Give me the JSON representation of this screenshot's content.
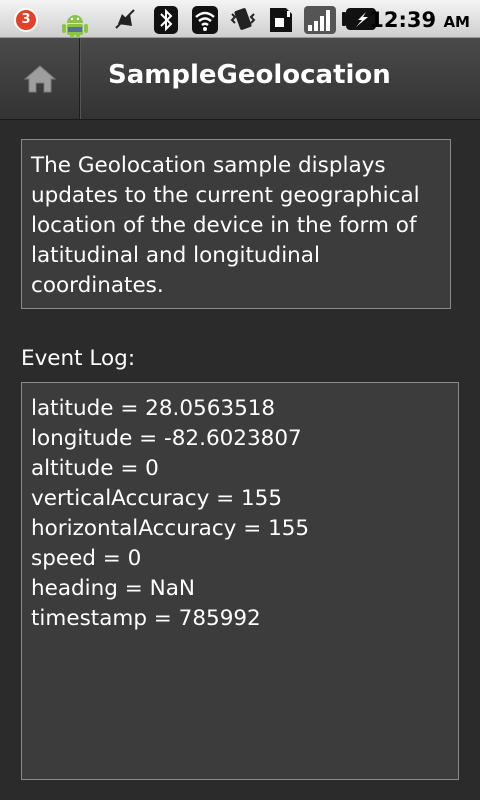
{
  "status_bar": {
    "notification_count": "3",
    "time": "12:39",
    "time_suffix": "AM"
  },
  "title_bar": {
    "title": "SampleGeolocation"
  },
  "description": "The Geolocation sample displays updates to the current geographical location of the device in the form of latitudinal and longitudinal coordinates.",
  "event_log": {
    "label": "Event Log:",
    "lines": [
      "latitude = 28.0563518",
      "longitude = -82.6023807",
      "altitude = 0",
      "verticalAccuracy = 155",
      "horizontalAccuracy = 155",
      "speed = 0",
      "heading = NaN",
      "timestamp = 785992"
    ]
  },
  "icons": {
    "notification": "notification-badge-icon",
    "app_notification": "android-robot-icon",
    "silent": "silent-mode-icon",
    "bluetooth": "bluetooth-icon",
    "wifi": "wifi-icon",
    "vibrate": "vibrate-icon",
    "sim": "sim-data-icon",
    "signal": "signal-strength-icon",
    "battery": "battery-charging-icon",
    "home": "home-icon"
  }
}
